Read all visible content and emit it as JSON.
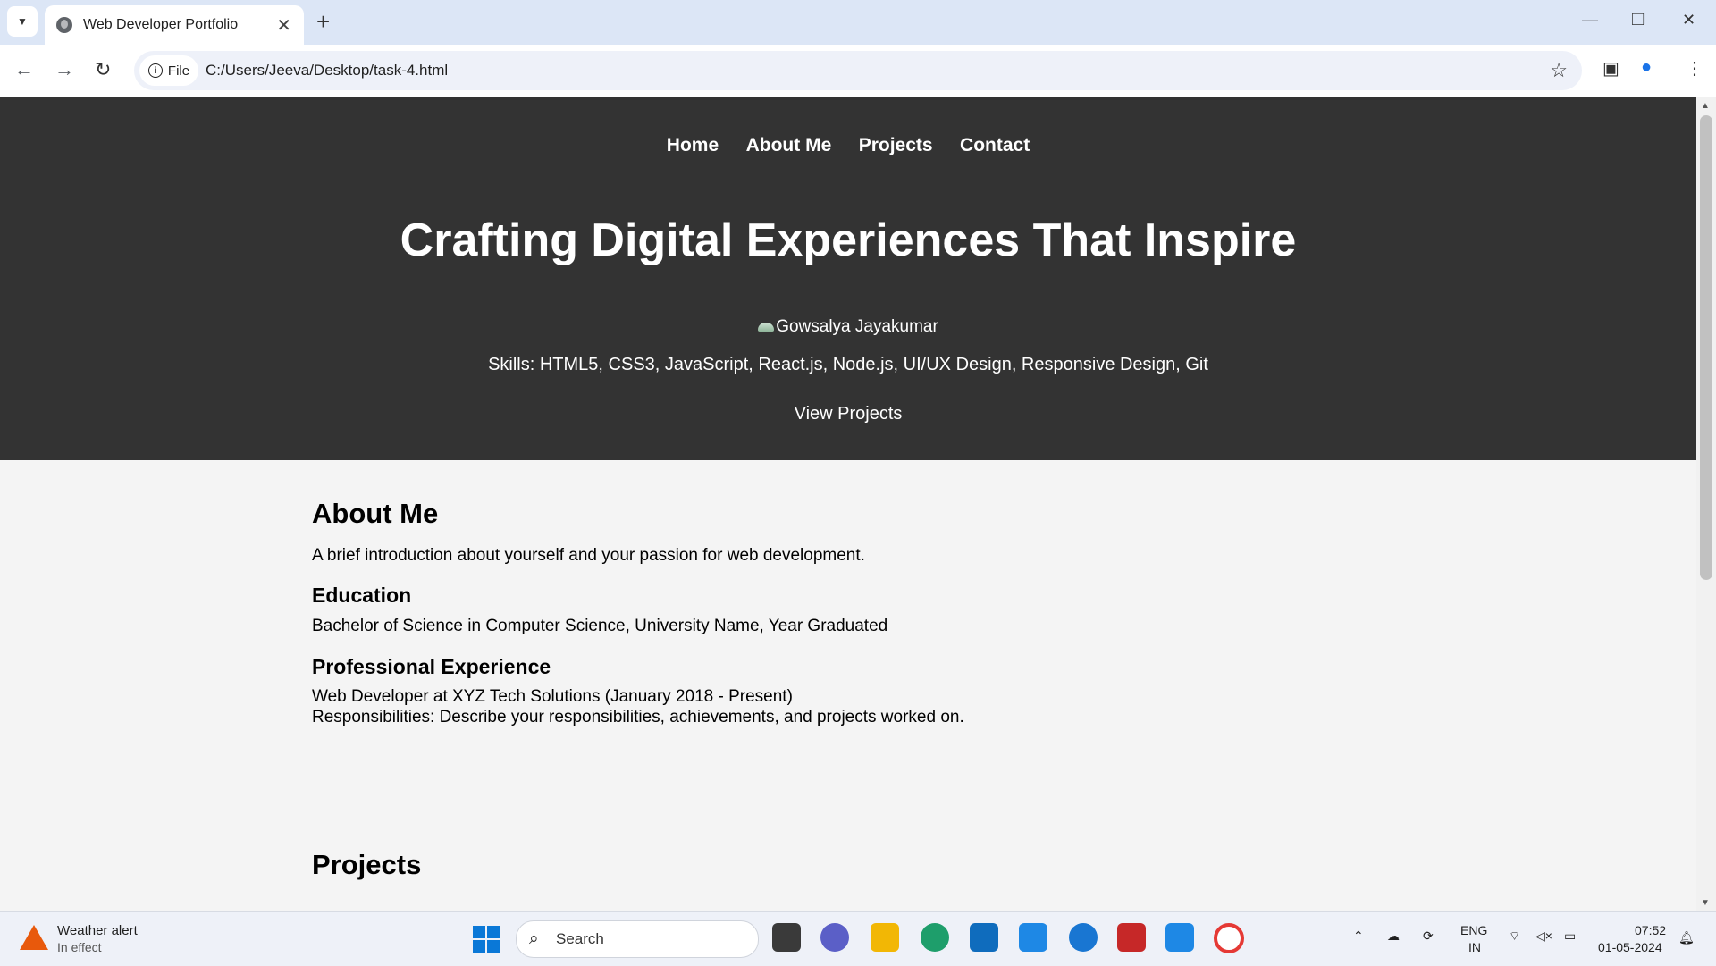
{
  "browser": {
    "tab_title": "Web Developer Portfolio",
    "chip_label": "File",
    "url": "C:/Users/Jeeva/Desktop/task-4.html"
  },
  "site": {
    "nav": [
      "Home",
      "About Me",
      "Projects",
      "Contact"
    ],
    "hero_title": "Crafting Digital Experiences That Inspire",
    "profile_alt": "Gowsalya Jayakumar",
    "skills": "Skills: HTML5, CSS3, JavaScript, React.js, Node.js, UI/UX Design, Responsive Design, Git",
    "cta": "View Projects"
  },
  "about": {
    "heading": "About Me",
    "intro": "A brief introduction about yourself and your passion for web development.",
    "education_heading": "Education",
    "education_text": "Bachelor of Science in Computer Science, University Name, Year Graduated",
    "experience_heading": "Professional Experience",
    "experience_line1": "Web Developer at XYZ Tech Solutions (January 2018 - Present)",
    "experience_line2": "Responsibilities: Describe your responsibilities, achievements, and projects worked on."
  },
  "projects": {
    "heading": "Projects"
  },
  "taskbar": {
    "weather_title": "Weather alert",
    "weather_sub": "In effect",
    "search_placeholder": "Search",
    "lang1": "ENG",
    "lang2": "IN",
    "time": "07:52",
    "date": "01-05-2024"
  },
  "colors": {
    "hero_bg": "#333333",
    "page_bg": "#f4f4f4",
    "tabstrip_bg": "#dce6f6"
  }
}
